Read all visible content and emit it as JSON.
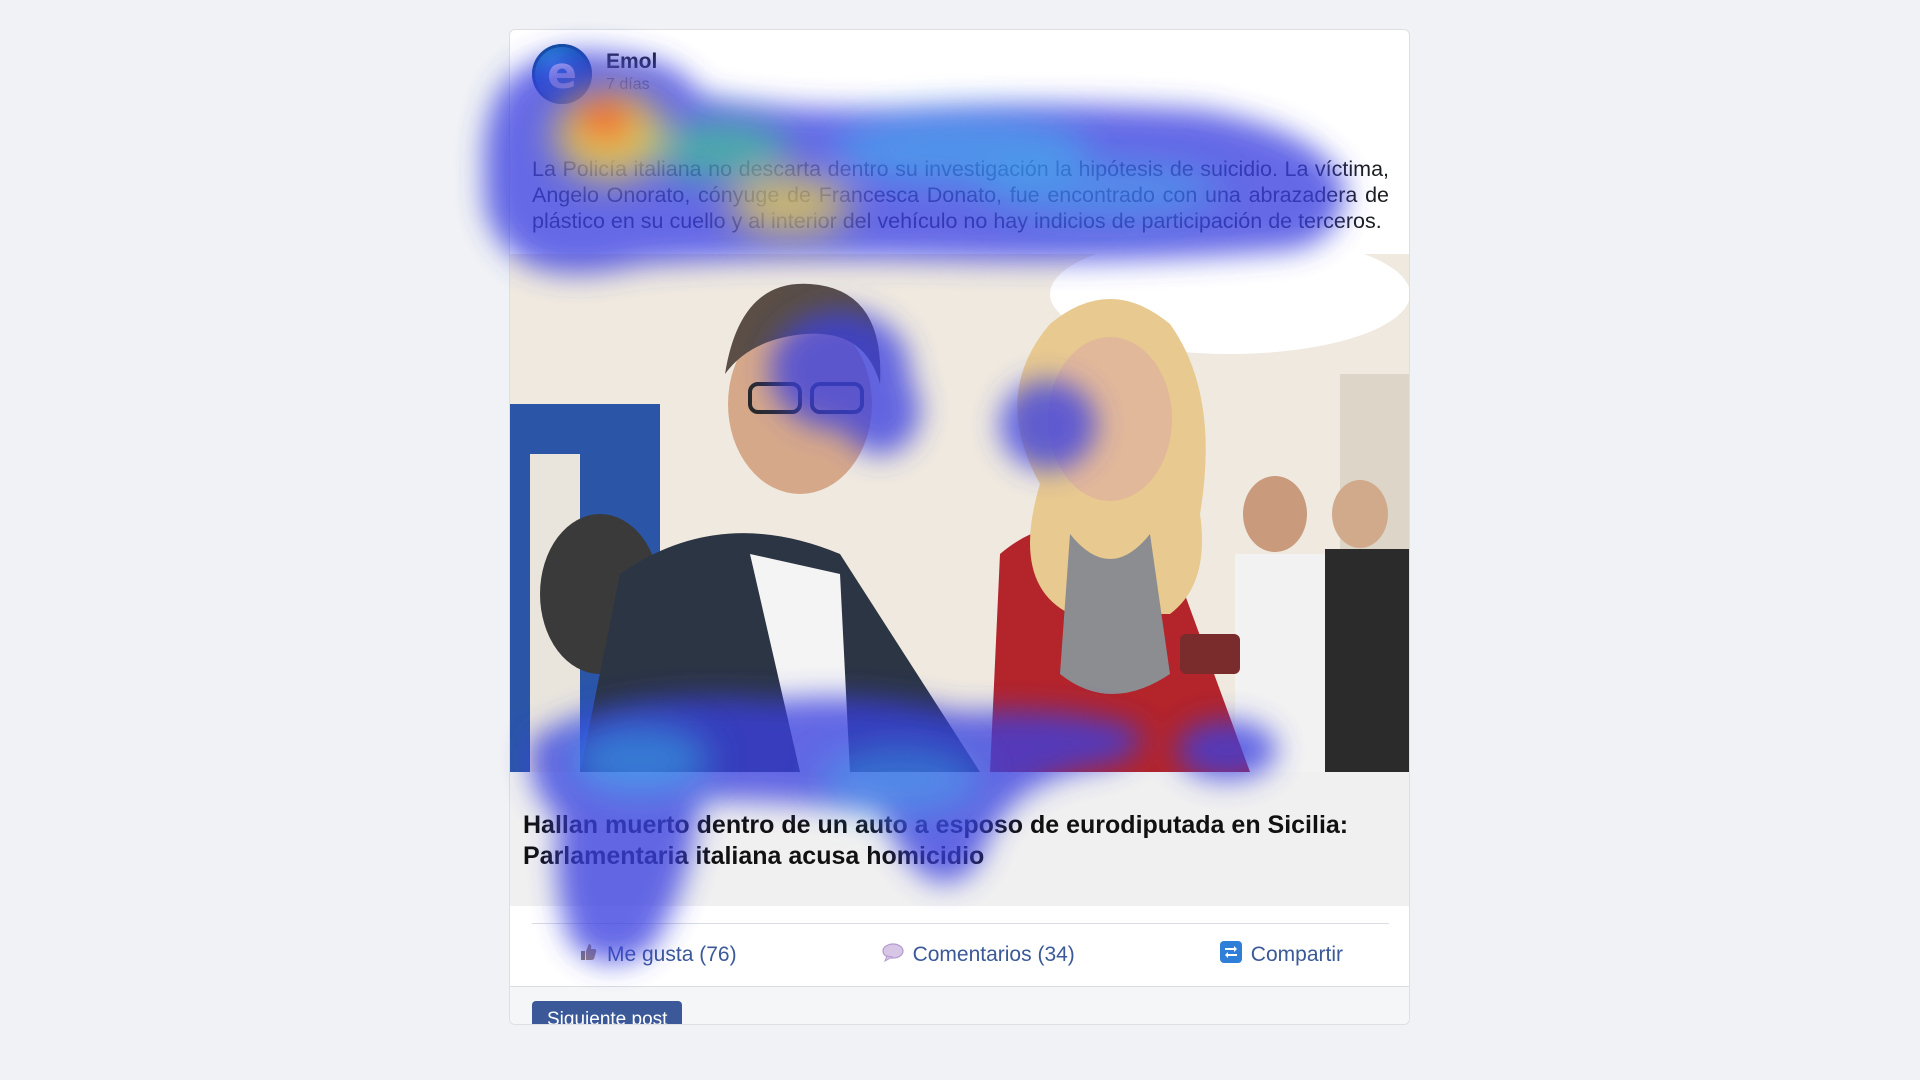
{
  "post": {
    "author": "Emol",
    "avatar_letter": "e",
    "time": "7 días",
    "text": "La Policía italiana no descarta dentro su investigación la hipótesis de suicidio. La víctima, Angelo Onorato, cónyuge de Francesca Donato, fue encontrado con una abrazadera de plástico en su cuello y al interior del vehículo no hay indicios de participación de terceros.",
    "link_title": "Hallan muerto dentro de un auto a esposo de eurodiputada en Sicilia: Parlamentaria italiana acusa homicidio"
  },
  "actions": {
    "like_label": "Me gusta (76)",
    "comment_label": "Comentarios (34)",
    "share_label": "Compartir",
    "like_icon": "thumbs-up-icon",
    "comment_icon": "speech-bubble-icon",
    "share_icon": "share-arrows-icon"
  },
  "footer": {
    "next_label": "Siguiente post"
  },
  "colors": {
    "accent": "#3b5998",
    "page_background": "#f0f2f5",
    "link_preview_background": "#f0f0f0"
  }
}
